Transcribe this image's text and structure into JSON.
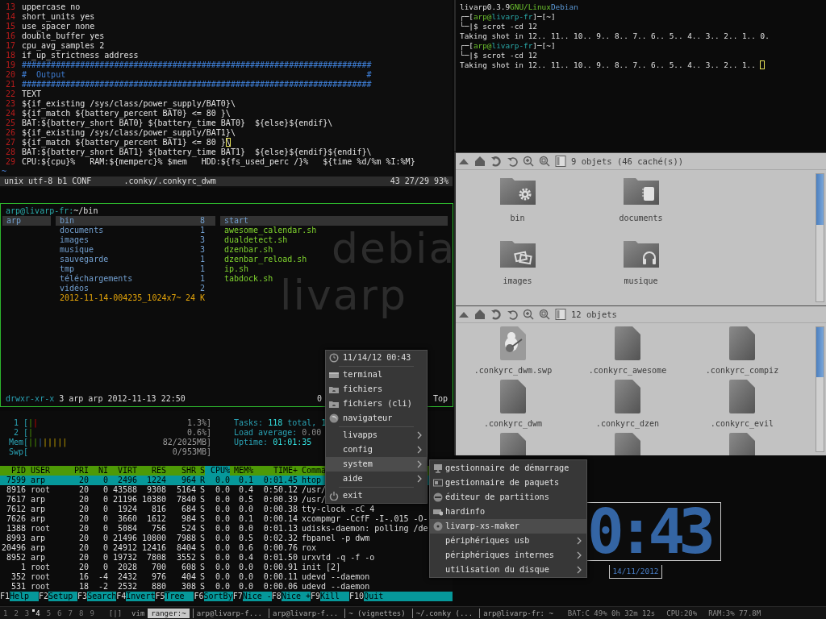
{
  "vim": {
    "lines": [
      {
        "number": "13",
        "text": "uppercase no",
        "kind": "code"
      },
      {
        "number": "14",
        "text": "short_units yes",
        "kind": "code"
      },
      {
        "number": "15",
        "text": "use_spacer none",
        "kind": "code"
      },
      {
        "number": "16",
        "text": "double_buffer yes",
        "kind": "code"
      },
      {
        "number": "17",
        "text": "cpu_avg_samples 2",
        "kind": "code"
      },
      {
        "number": "18",
        "text": "if_up_strictness address",
        "kind": "code"
      },
      {
        "number": "19",
        "text": "########################################################################",
        "kind": "comment"
      },
      {
        "number": "20",
        "text": "#  Output                                                              #",
        "kind": "comment"
      },
      {
        "number": "21",
        "text": "########################################################################",
        "kind": "comment"
      },
      {
        "number": "22",
        "text": "TEXT",
        "kind": "code"
      },
      {
        "number": "23",
        "text": "${if_existing /sys/class/power_supply/BAT0}\\",
        "kind": "code"
      },
      {
        "number": "24",
        "text": "${if_match ${battery_percent BAT0} <= 80 }\\",
        "kind": "code"
      },
      {
        "number": "25",
        "text": "BAT:${battery_short BAT0} ${battery_time BAT0}  ${else}${endif}\\",
        "kind": "code"
      },
      {
        "number": "26",
        "text": "${if_existing /sys/class/power_supply/BAT1}\\",
        "kind": "code"
      },
      {
        "number": "27",
        "text": "${if_match ${battery_percent BAT1} <= 80 }",
        "cursor": "\\",
        "kind": "code"
      },
      {
        "number": "28",
        "text": "BAT:${battery_short BAT1} ${battery_time BAT1}  ${else}${endif}${endif}\\",
        "kind": "code"
      },
      {
        "number": "29",
        "text": "CPU:${cpu}%   RAM:${memperc}% $mem   HDD:${fs_used_perc /}%   ${time %d/%m %I:%M}",
        "kind": "code"
      }
    ],
    "empty_marker": "~",
    "status": [
      "unix utf-8 b1 CONF",
      ".conky/.conkyrc_dwm",
      "43 27/29 93%"
    ]
  },
  "ranger": {
    "path": [
      {
        "text": "arp@livarp-fr:",
        "kind": "host"
      },
      {
        "text": "~/bin",
        "kind": "plain"
      }
    ],
    "parent": [
      {
        "name": "arp",
        "selected": true
      }
    ],
    "current": [
      {
        "name": "bin",
        "size": "8",
        "kind": "dir",
        "selected": true
      },
      {
        "name": "documents",
        "size": "1",
        "kind": "dir",
        "selected": false
      },
      {
        "name": "images",
        "size": "3",
        "kind": "dir",
        "selected": false
      },
      {
        "name": "musique",
        "size": "3",
        "kind": "dir",
        "selected": false
      },
      {
        "name": "sauvegarde",
        "size": "1",
        "kind": "dir",
        "selected": false
      },
      {
        "name": "tmp",
        "size": "1",
        "kind": "dir",
        "selected": false
      },
      {
        "name": "téléchargements",
        "size": "1",
        "kind": "dir",
        "selected": false
      },
      {
        "name": "vidéos",
        "size": "2",
        "kind": "dir",
        "selected": false
      },
      {
        "name": "2012-11-14-004235_1024x7~",
        "size": "24 K",
        "kind": "image",
        "selected": false
      }
    ],
    "preview": [
      {
        "name": "start",
        "kind": "dir",
        "selected": true
      },
      {
        "name": "awesome_calendar.sh",
        "kind": "exec",
        "selected": false
      },
      {
        "name": "dualdetect.sh",
        "kind": "exec",
        "selected": false
      },
      {
        "name": "dzenbar.sh",
        "kind": "exec",
        "selected": false
      },
      {
        "name": "dzenbar_reload.sh",
        "kind": "exec",
        "selected": false
      },
      {
        "name": "ip.sh",
        "kind": "exec",
        "selected": false
      },
      {
        "name": "tabdock.sh",
        "kind": "exec",
        "selected": false
      }
    ],
    "wallpaper_text": [
      "debia",
      "livarp"
    ],
    "status": {
      "perms": "drwxr-xr-x",
      "info": "3 arp arp 2012-11-13 22:50",
      "count": "0",
      "position": "Top"
    }
  },
  "htop": {
    "meters": [
      {
        "label": "1 [",
        "bars": [
          {
            "text": "|",
            "kind": "user"
          },
          {
            "text": "|",
            "kind": "kernel"
          }
        ],
        "value": "1.3%]"
      },
      {
        "label": "2 [",
        "bars": [
          {
            "text": "|",
            "kind": "user"
          }
        ],
        "value": "0.6%]"
      },
      {
        "label": "Mem[",
        "bars": [
          {
            "text": "||",
            "kind": "user"
          },
          {
            "text": "|",
            "kind": "buffers"
          },
          {
            "text": "|||||",
            "kind": "cache"
          }
        ],
        "value": "82/2025MB]"
      },
      {
        "label": "Swp[",
        "value": "0/953MB]"
      }
    ],
    "info": [
      {
        "segments": [
          {
            "text": "Tasks: ",
            "kind": "label"
          },
          {
            "text": "118",
            "kind": "value"
          },
          {
            "text": " total, ",
            "kind": "label"
          },
          {
            "text": "1",
            "kind": "value"
          }
        ]
      },
      {
        "segments": [
          {
            "text": "Load average: ",
            "kind": "label"
          },
          {
            "text": "0.00",
            "kind": "dim"
          }
        ]
      },
      {
        "segments": [
          {
            "text": "Uptime: ",
            "kind": "label"
          },
          {
            "text": "01:01:35",
            "kind": "value"
          }
        ]
      }
    ],
    "columns": [
      {
        "label": "PID",
        "selected": false
      },
      {
        "label": "USER",
        "selected": false
      },
      {
        "label": "PRI",
        "selected": false
      },
      {
        "label": "NI",
        "selected": false
      },
      {
        "label": "VIRT",
        "selected": false
      },
      {
        "label": "RES",
        "selected": false
      },
      {
        "label": "SHR",
        "selected": false
      },
      {
        "label": "S",
        "selected": false
      },
      {
        "label": "CPU%",
        "selected": true
      },
      {
        "label": "MEM%",
        "selected": false
      },
      {
        "label": "TIME+",
        "selected": false
      },
      {
        "label": "Comma",
        "selected": false
      }
    ],
    "rows": [
      {
        "cells": [
          "7599",
          "arp",
          "20",
          "0",
          "2496",
          "1224",
          "964",
          "R",
          "0.0",
          "0.1",
          "0:01.45",
          "htop"
        ],
        "selected": true
      },
      {
        "cells": [
          "8916",
          "root",
          "20",
          "0",
          "43588",
          "9308",
          "5164",
          "S",
          "0.0",
          "0.4",
          "0:50.12",
          "/usr/"
        ],
        "selected": false
      },
      {
        "cells": [
          "7617",
          "arp",
          "20",
          "0",
          "21196",
          "10380",
          "7840",
          "S",
          "0.0",
          "0.5",
          "0:00.39",
          "/usr/"
        ],
        "selected": false
      },
      {
        "cells": [
          "7612",
          "arp",
          "20",
          "0",
          "1924",
          "816",
          "684",
          "S",
          "0.0",
          "0.0",
          "0:00.38",
          "tty-clock -cC 4"
        ],
        "selected": false
      },
      {
        "cells": [
          "7626",
          "arp",
          "20",
          "0",
          "3660",
          "1612",
          "984",
          "S",
          "0.0",
          "0.1",
          "0:00.14",
          "xcompmgr -CcfF -I-.015 -O-"
        ],
        "selected": false
      },
      {
        "cells": [
          "1388",
          "root",
          "20",
          "0",
          "5084",
          "756",
          "524",
          "S",
          "0.0",
          "0.0",
          "0:01.13",
          "udisks-daemon: polling /de"
        ],
        "selected": false
      },
      {
        "cells": [
          "8993",
          "arp",
          "20",
          "0",
          "21496",
          "10800",
          "7988",
          "S",
          "0.0",
          "0.5",
          "0:02.32",
          "fbpanel -p dwm"
        ],
        "selected": false
      },
      {
        "cells": [
          "20496",
          "arp",
          "20",
          "0",
          "24912",
          "12416",
          "8404",
          "S",
          "0.0",
          "0.6",
          "0:00.76",
          "rox"
        ],
        "selected": false
      },
      {
        "cells": [
          "8952",
          "arp",
          "20",
          "0",
          "19732",
          "7808",
          "3552",
          "S",
          "0.0",
          "0.4",
          "0:01.50",
          "urxvtd -q -f -o"
        ],
        "selected": false
      },
      {
        "cells": [
          "1",
          "root",
          "20",
          "0",
          "2028",
          "700",
          "608",
          "S",
          "0.0",
          "0.0",
          "0:00.91",
          "init [2]"
        ],
        "selected": false
      },
      {
        "cells": [
          "352",
          "root",
          "16",
          "-4",
          "2432",
          "976",
          "404",
          "S",
          "0.0",
          "0.0",
          "0:00.11",
          "udevd --daemon"
        ],
        "selected": false
      },
      {
        "cells": [
          "531",
          "root",
          "18",
          "-2",
          "2532",
          "880",
          "308",
          "S",
          "0.0",
          "0.0",
          "0:00.06",
          "udevd --daemon"
        ],
        "selected": false
      }
    ],
    "fkeys": [
      {
        "key": "F1",
        "label": "Help"
      },
      {
        "key": "F2",
        "label": "Setup"
      },
      {
        "key": "F3",
        "label": "Search"
      },
      {
        "key": "F4",
        "label": "Invert"
      },
      {
        "key": "F5",
        "label": "Tree"
      },
      {
        "key": "F6",
        "label": "SortBy"
      },
      {
        "key": "F7",
        "label": "Nice -"
      },
      {
        "key": "F8",
        "label": "Nice +"
      },
      {
        "key": "F9",
        "label": "Kill"
      },
      {
        "key": "F10",
        "label": "Quit"
      }
    ]
  },
  "terminal": {
    "lines": [
      {
        "segments": [
          {
            "text": "livarp0.3.9",
            "kind": "plain"
          },
          {
            "text": "GNU/Linux",
            "kind": "user"
          },
          {
            "text": "Debian",
            "kind": "distro"
          }
        ],
        "cursor": false
      },
      {
        "segments": [
          {
            "text": "┌─[",
            "kind": "plain"
          },
          {
            "text": "arp@",
            "kind": "user"
          },
          {
            "text": "livarp-fr",
            "kind": "host"
          },
          {
            "text": "]─[~]",
            "kind": "plain"
          }
        ],
        "cursor": false
      },
      {
        "segments": [
          {
            "text": "└─|$ scrot -cd 12",
            "kind": "plain"
          }
        ],
        "cursor": false
      },
      {
        "segments": [
          {
            "text": "Taking shot in 12.. 11.. 10.. 9.. 8.. 7.. 6.. 5.. 4.. 3.. 2.. 1.. 0.",
            "kind": "plain"
          }
        ],
        "cursor": false
      },
      {
        "segments": [
          {
            "text": "┌─[",
            "kind": "plain"
          },
          {
            "text": "arp@",
            "kind": "user"
          },
          {
            "text": "livarp-fr",
            "kind": "host"
          },
          {
            "text": "]─[~]",
            "kind": "plain"
          }
        ],
        "cursor": false
      },
      {
        "segments": [
          {
            "text": "└─|$ scrot -cd 12",
            "kind": "plain"
          }
        ],
        "cursor": false
      },
      {
        "segments": [
          {
            "text": "Taking shot in 12.. 11.. 10.. 9.. 8.. 7.. 6.. 5.. 4.. 3.. 2.. 1..",
            "kind": "plain"
          }
        ],
        "cursor": true
      }
    ]
  },
  "file_managers": [
    {
      "status": "9 objets (46 caché(s))",
      "items": [
        {
          "label": "bin",
          "kind": "folder"
        },
        {
          "label": "documents",
          "kind": "folder"
        },
        {
          "label": "images",
          "kind": "folder"
        },
        {
          "label": "musique",
          "kind": "folder"
        }
      ]
    },
    {
      "status": "12 objets",
      "items": [
        {
          "label": ".conkyrc_dwm.swp",
          "kind": "preview"
        },
        {
          "label": ".conkyrc_awesome",
          "kind": "file"
        },
        {
          "label": ".conkyrc_compiz",
          "kind": "file"
        },
        {
          "label": ".conkyrc_dwm",
          "kind": "file"
        },
        {
          "label": ".conkyrc_dzen",
          "kind": "file"
        },
        {
          "label": ".conkyrc_evil",
          "kind": "file"
        },
        {
          "kind": "file"
        },
        {
          "kind": "file"
        },
        {
          "kind": "file"
        }
      ]
    }
  ],
  "clock": {
    "time": "0:43",
    "date": "14/11/2012"
  },
  "menu": {
    "header": "11/14/12 00:43",
    "groups": [
      [
        {
          "label": "terminal",
          "submenu": false,
          "selected": false
        },
        {
          "label": "fichiers",
          "submenu": false,
          "selected": false
        },
        {
          "label": "fichiers (cli)",
          "submenu": false,
          "selected": false
        },
        {
          "label": "navigateur",
          "submenu": false,
          "selected": false
        }
      ],
      [
        {
          "label": "livapps",
          "submenu": true,
          "selected": false
        },
        {
          "label": "config",
          "submenu": true,
          "selected": false
        },
        {
          "label": "system",
          "submenu": true,
          "selected": true
        },
        {
          "label": "aide",
          "submenu": true,
          "selected": false
        }
      ],
      [
        {
          "label": "exit",
          "submenu": false,
          "selected": false
        }
      ]
    ]
  },
  "submenu": {
    "items": [
      {
        "label": "gestionnaire de démarrage",
        "submenu": false,
        "selected": false
      },
      {
        "label": "gestionnaire de paquets",
        "submenu": false,
        "selected": false
      },
      {
        "label": "éditeur de partitions",
        "submenu": false,
        "selected": false
      },
      {
        "label": "hardinfo",
        "submenu": false,
        "selected": false
      },
      {
        "label": "livarp-xs-maker",
        "submenu": false,
        "selected": true
      },
      {
        "label": "périphériques usb",
        "submenu": true,
        "selected": false
      },
      {
        "label": "périphériques internes",
        "submenu": true,
        "selected": false
      },
      {
        "label": "utilisation du disque",
        "submenu": true,
        "selected": false
      }
    ]
  },
  "taskbar": {
    "tags": [
      {
        "label": "1",
        "selected": false
      },
      {
        "label": "2",
        "selected": false
      },
      {
        "label": "3",
        "selected": false
      },
      {
        "label": "4",
        "selected": true
      },
      {
        "label": "5",
        "selected": false
      },
      {
        "label": "6",
        "selected": false
      },
      {
        "label": "7",
        "selected": false
      },
      {
        "label": "8",
        "selected": false
      },
      {
        "label": "9",
        "selected": false
      }
    ],
    "layout": "[|]",
    "windows": [
      {
        "title": "vim",
        "selected": false
      },
      {
        "title": "ranger:~",
        "selected": true
      },
      {
        "title": "arp@livarp-f...",
        "selected": false
      },
      {
        "title": "arp@livarp-f...",
        "selected": false
      },
      {
        "title": "~ (vignettes)",
        "selected": false
      },
      {
        "title": "~/.conky (...",
        "selected": false
      },
      {
        "title": "arp@livarp-fr: ~",
        "selected": false
      }
    ],
    "status": [
      "BAT:C 49% 0h 32m 12s",
      "CPU:20%",
      "RAM:3% 77.8M"
    ]
  }
}
